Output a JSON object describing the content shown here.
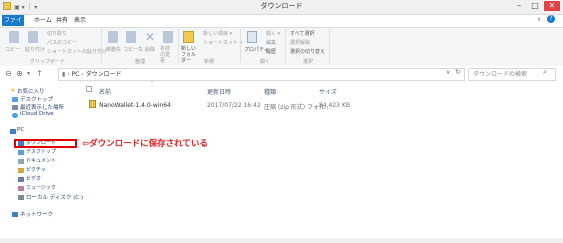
{
  "window": {
    "title": "ダウンロード",
    "minimize_glyph": "–",
    "maximize_glyph": "□",
    "close_glyph": "✕"
  },
  "ribbon": {
    "tabs": [
      "ファイル",
      "ホーム",
      "共有",
      "表示"
    ],
    "clipboard": {
      "copy": "コピー",
      "paste": "貼り付け",
      "cut": "切り取り",
      "copy_path": "パスのコピー",
      "paste_shortcut": "ショートカットの貼り付け",
      "group": "クリップボード"
    },
    "organize": {
      "move_to": "移動先",
      "copy_to": "コピー先",
      "delete": "削除",
      "rename": "名前の変更",
      "group": "整理"
    },
    "new": {
      "new_folder": "新しいフォルダー",
      "new_item": "新しい項目 ▾",
      "shortcut": "ショートカット ▾",
      "group": "新規"
    },
    "open": {
      "properties": "プロパティ",
      "open": "開く ▾",
      "edit": "編集",
      "history": "履歴",
      "group": "開く"
    },
    "select": {
      "select_all": "すべて選択",
      "select_none": "選択解除",
      "invert": "選択の切り替え",
      "group": "選択"
    }
  },
  "address": {
    "path_root": "PC",
    "path_folder": "ダウンロード",
    "search_placeholder": "ダウンロードの検索"
  },
  "columns": {
    "name": "名前",
    "date": "更新日時",
    "type": "種類",
    "size": "サイズ"
  },
  "files": [
    {
      "name": "NanoWallet-1.4.0-win64",
      "date": "2017/07/22 16:42",
      "type": "圧縮 (zip 形式) フォル...",
      "size": "84,423 KB"
    }
  ],
  "sidebar": {
    "favorites": "お気に入り",
    "desktop": "デスクトップ",
    "recent": "最近表示した場所",
    "icloud": "iCloud Drive",
    "pc": "PC",
    "downloads": "ダウンロード",
    "desktop2": "デスクトップ",
    "documents": "ドキュメント",
    "pictures": "ピクチャ",
    "videos": "ビデオ",
    "music": "ミュージック",
    "local_disk": "ローカル ディスク (C:)",
    "network": "ネットワーク"
  },
  "annotation": {
    "text": "⇦ダウンロードに保存されている",
    "color": "#e02020"
  },
  "colors": {
    "accent": "#1979ca",
    "highlight": "#e00000"
  }
}
